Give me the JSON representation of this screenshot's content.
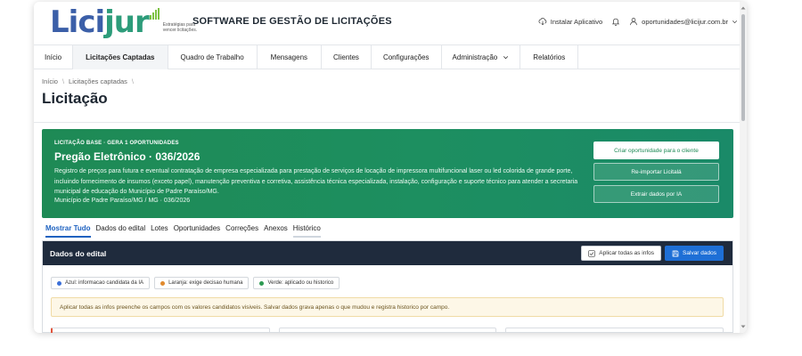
{
  "brand": {
    "logo_a": "Lici",
    "logo_b": "jur",
    "tagline": "Estratégias para vencer licitações.",
    "colors": {
      "logo_blue": "#3b5fa8",
      "logo_green": "#2d9c7a",
      "accent_green": "#1e8a55",
      "accent_blue": "#1e6fd6",
      "panel_dark": "#1f2b3d"
    }
  },
  "header": {
    "title": "SOFTWARE DE GESTÃO DE LICITAÇÕES",
    "install_label": "Instalar Aplicativo",
    "install_icon": "cloud-download-icon",
    "bell_icon": "bell-icon",
    "user_icon": "user-icon",
    "user_email": "oportunidades@licijur.com.br"
  },
  "nav": {
    "items": [
      {
        "label": "Início"
      },
      {
        "label": "Licitações Captadas"
      },
      {
        "label": "Quadro de Trabalho"
      },
      {
        "label": "Mensagens"
      },
      {
        "label": "Clientes"
      },
      {
        "label": "Configurações"
      },
      {
        "label": "Administração"
      },
      {
        "label": "Relatórios"
      }
    ]
  },
  "breadcrumb": {
    "home": "Início",
    "sep": "\\",
    "section": "Licitações captadas"
  },
  "page": {
    "title": "Licitação"
  },
  "banner": {
    "kicker": "LICITAÇÃO BASE · GERA 1 OPORTUNIDADES",
    "title": "Pregão Eletrônico · 036/2026",
    "description": "Registro de preços para futura e eventual contratação de empresa especializada para prestação de serviços de locação de impressora multifuncional laser ou led colorida de grande porte, incluindo fornecimento de insumos (exceto papel), manutenção preventiva e corretiva, assistência técnica especializada, instalação, configuração e suporte técnico para atender a secretaria municipal de educação do Município de Padre Paraíso/MG.",
    "meta": "Município de Padre Paraíso/MG / MG · 036/2026",
    "btn_create": "Criar oportunidade para o cliente",
    "btn_reimport": "Re-importar Licitalá",
    "btn_extract": "Extrair dados por IA"
  },
  "tabs": [
    "Mostrar Tudo",
    "Dados do edital",
    "Lotes",
    "Oportunidades",
    "Correções",
    "Anexos",
    "Histórico"
  ],
  "panel": {
    "title": "Dados do edital",
    "apply_all": "Aplicar todas as infos",
    "save": "Salvar dados",
    "legend": [
      {
        "label": "Azul: informacao candidata da IA",
        "color": "#3b6fd8"
      },
      {
        "label": "Laranja: exige decisao humana",
        "color": "#e08a2e"
      },
      {
        "label": "Verde: aplicado ou historico",
        "color": "#2e9a52"
      }
    ],
    "notice": "Aplicar todas as infos preenche os campos com os valores candidatos visiveis. Salvar dados grava apenas o que mudou e registra historico por campo."
  }
}
